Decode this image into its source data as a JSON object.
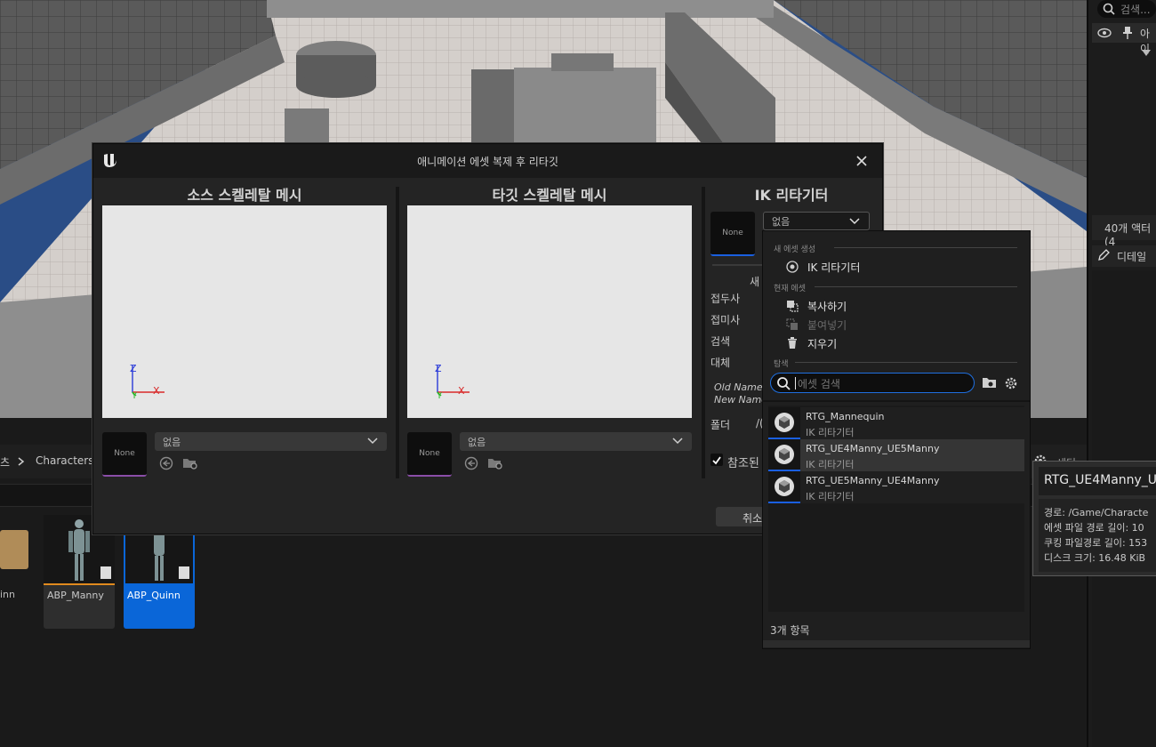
{
  "window_title": "애니메이션 에셋 복제 후 리타깃",
  "source_panel": {
    "title": "소스 스켈레탈 메시",
    "thumb": "None",
    "combo": "없음"
  },
  "target_panel": {
    "title": "타깃 스켈레탈 메시",
    "thumb": "None",
    "combo": "없음"
  },
  "ik_panel": {
    "title": "IK 리타기터",
    "thumb": "None",
    "combo": "없음",
    "labels": {
      "new": "새",
      "prefix": "접두사",
      "suffix": "접미사",
      "search": "검색",
      "replace": "대체"
    },
    "old_name": "Old Name",
    "new_name": "New Name",
    "folder_label": "폴더",
    "folder_value": "/(",
    "checkbox_label": "참조된",
    "cancel": "취소"
  },
  "axis": {
    "x": "X",
    "y": "Y",
    "z": "Z"
  },
  "menu": {
    "section_new": "새 에셋 생성",
    "create_ik": "IK 리타기터",
    "section_current": "현재 에셋",
    "copy": "복사하기",
    "paste": "붙여넣기",
    "delete": "지우기",
    "section_browse": "탐색",
    "search_placeholder": "에셋 검색",
    "items": [
      {
        "name": "RTG_Mannequin",
        "type": "IK 리타기터"
      },
      {
        "name": "RTG_UE4Manny_UE5Manny",
        "type": "IK 리타기터"
      },
      {
        "name": "RTG_UE5Manny_UE4Manny",
        "type": "IK 리타기터"
      }
    ],
    "count": "3개 항목"
  },
  "tooltip": {
    "title": "RTG_UE4Manny_U",
    "path": "경로: /Game/Characte",
    "asset_path_len": "에셋 파일 경로 길이: 10",
    "cook_path_len": "쿠킹 파일경로 길이: 153",
    "disk_size": "디스크 크기: 16.48 KiB"
  },
  "outliner": {
    "search": "검색...",
    "col": "아이",
    "actors": "40개 액터(4",
    "details": "디테일"
  },
  "content_browser": {
    "crumb_prev": "츠",
    "crumb": "Characters",
    "settings": "세팅",
    "assets": [
      {
        "name": "inn"
      },
      {
        "name": "ABP_Manny"
      },
      {
        "name": "ABP_Quinn"
      }
    ]
  },
  "colors": {
    "accent": "#0070e0",
    "selected": "#0a66d8"
  }
}
